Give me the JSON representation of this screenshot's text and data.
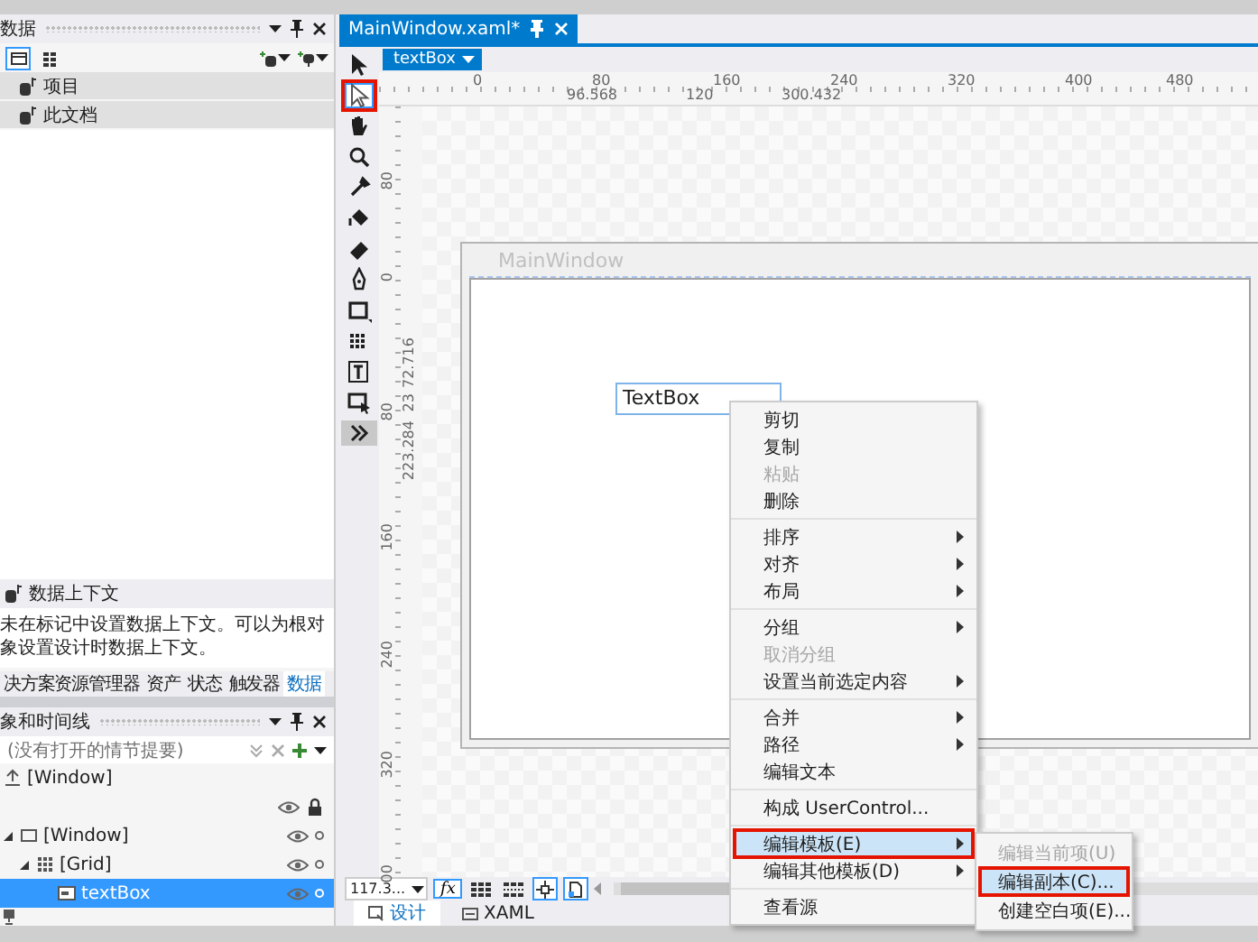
{
  "left_panel": {
    "data_panel": {
      "title": "数据",
      "items": [
        {
          "label": "项目"
        },
        {
          "label": "此文档"
        }
      ],
      "context_title": "数据上下文",
      "context_text": "未在标记中设置数据上下文。可以为根对象设置设计时数据上下文。"
    },
    "tabs": [
      {
        "label": "决方案资源管理器",
        "selected": false
      },
      {
        "label": "资产",
        "selected": false
      },
      {
        "label": "状态",
        "selected": false
      },
      {
        "label": "触发器",
        "selected": false
      },
      {
        "label": "数据",
        "selected": true
      }
    ],
    "objects_panel": {
      "title": "象和时间线",
      "storyboard": "(没有打开的情节提要)",
      "root": "[Window]",
      "tree": [
        {
          "label": "[Window]",
          "kind": "window",
          "expanded": true,
          "selected": false,
          "children": [
            {
              "label": "[Grid]",
              "kind": "grid",
              "expanded": true,
              "selected": false,
              "children": [
                {
                  "label": "textBox",
                  "kind": "textbox",
                  "selected": true
                }
              ]
            }
          ]
        }
      ]
    }
  },
  "designer": {
    "document_tab": {
      "title": "MainWindow.xaml*"
    },
    "breadcrumb": "textBox",
    "tools": [
      {
        "kind": "select",
        "marked": false
      },
      {
        "kind": "direct-select",
        "marked": true
      },
      {
        "kind": "pan",
        "marked": false
      },
      {
        "kind": "zoom",
        "marked": false
      },
      {
        "kind": "eyedropper",
        "marked": false
      },
      {
        "kind": "bucket",
        "marked": false
      },
      {
        "kind": "eraser",
        "marked": false
      },
      {
        "kind": "pen",
        "marked": false
      },
      {
        "kind": "rectangle",
        "marked": false
      },
      {
        "kind": "grid",
        "marked": false
      },
      {
        "kind": "text",
        "marked": false
      },
      {
        "kind": "control",
        "marked": false
      },
      {
        "kind": "more",
        "marked": false
      }
    ],
    "ruler_h": {
      "labels": [
        "0",
        "80",
        "160",
        "240",
        "320",
        "400",
        "480"
      ],
      "measures": [
        "96.568",
        "120",
        "300.432"
      ]
    },
    "ruler_v": {
      "labels": [
        "80",
        "0",
        "80",
        "160",
        "240",
        "320",
        "00"
      ],
      "measures": [
        "72.716",
        "23",
        "223.284"
      ]
    },
    "window_title": "MainWindow",
    "textbox_text": "TextBox",
    "zoom": "117.3...",
    "fx": "fx",
    "view_tabs": [
      {
        "label": "设计",
        "kind": "design",
        "selected": true
      },
      {
        "label": "XAML",
        "kind": "xaml",
        "selected": false
      }
    ],
    "context_menu": {
      "groups": [
        {
          "items": [
            {
              "label": "剪切",
              "disabled": false,
              "submenu": false,
              "selected": false,
              "marked": false
            },
            {
              "label": "复制",
              "disabled": false,
              "submenu": false,
              "selected": false,
              "marked": false
            },
            {
              "label": "粘贴",
              "disabled": true,
              "submenu": false,
              "selected": false,
              "marked": false
            },
            {
              "label": "删除",
              "disabled": false,
              "submenu": false,
              "selected": false,
              "marked": false
            }
          ]
        },
        {
          "items": [
            {
              "label": "排序",
              "disabled": false,
              "submenu": true,
              "selected": false,
              "marked": false
            },
            {
              "label": "对齐",
              "disabled": false,
              "submenu": true,
              "selected": false,
              "marked": false
            },
            {
              "label": "布局",
              "disabled": false,
              "submenu": true,
              "selected": false,
              "marked": false
            }
          ]
        },
        {
          "items": [
            {
              "label": "分组",
              "disabled": false,
              "submenu": true,
              "selected": false,
              "marked": false
            },
            {
              "label": "取消分组",
              "disabled": true,
              "submenu": false,
              "selected": false,
              "marked": false
            },
            {
              "label": "设置当前选定内容",
              "disabled": false,
              "submenu": true,
              "selected": false,
              "marked": false
            }
          ]
        },
        {
          "items": [
            {
              "label": "合并",
              "disabled": false,
              "submenu": true,
              "selected": false,
              "marked": false
            },
            {
              "label": "路径",
              "disabled": false,
              "submenu": true,
              "selected": false,
              "marked": false
            },
            {
              "label": "编辑文本",
              "disabled": false,
              "submenu": false,
              "selected": false,
              "marked": false
            }
          ]
        },
        {
          "items": [
            {
              "label": "构成 UserControl...",
              "disabled": false,
              "submenu": false,
              "selected": false,
              "marked": false
            }
          ]
        },
        {
          "items": [
            {
              "label": "编辑模板(E)",
              "disabled": false,
              "submenu": true,
              "selected": true,
              "marked": true,
              "items": [
                {
                  "label": "编辑当前项(U)",
                  "disabled": true,
                  "selected": false,
                  "marked": false
                },
                {
                  "label": "编辑副本(C)...",
                  "disabled": false,
                  "selected": true,
                  "marked": true
                },
                {
                  "label": "创建空白项(E)...",
                  "disabled": false,
                  "selected": false,
                  "marked": false
                }
              ]
            },
            {
              "label": "编辑其他模板(D)",
              "disabled": false,
              "submenu": true,
              "selected": false,
              "marked": false
            }
          ]
        },
        {
          "items": [
            {
              "label": "查看源",
              "disabled": false,
              "submenu": false,
              "selected": false,
              "marked": false
            }
          ]
        }
      ]
    }
  }
}
